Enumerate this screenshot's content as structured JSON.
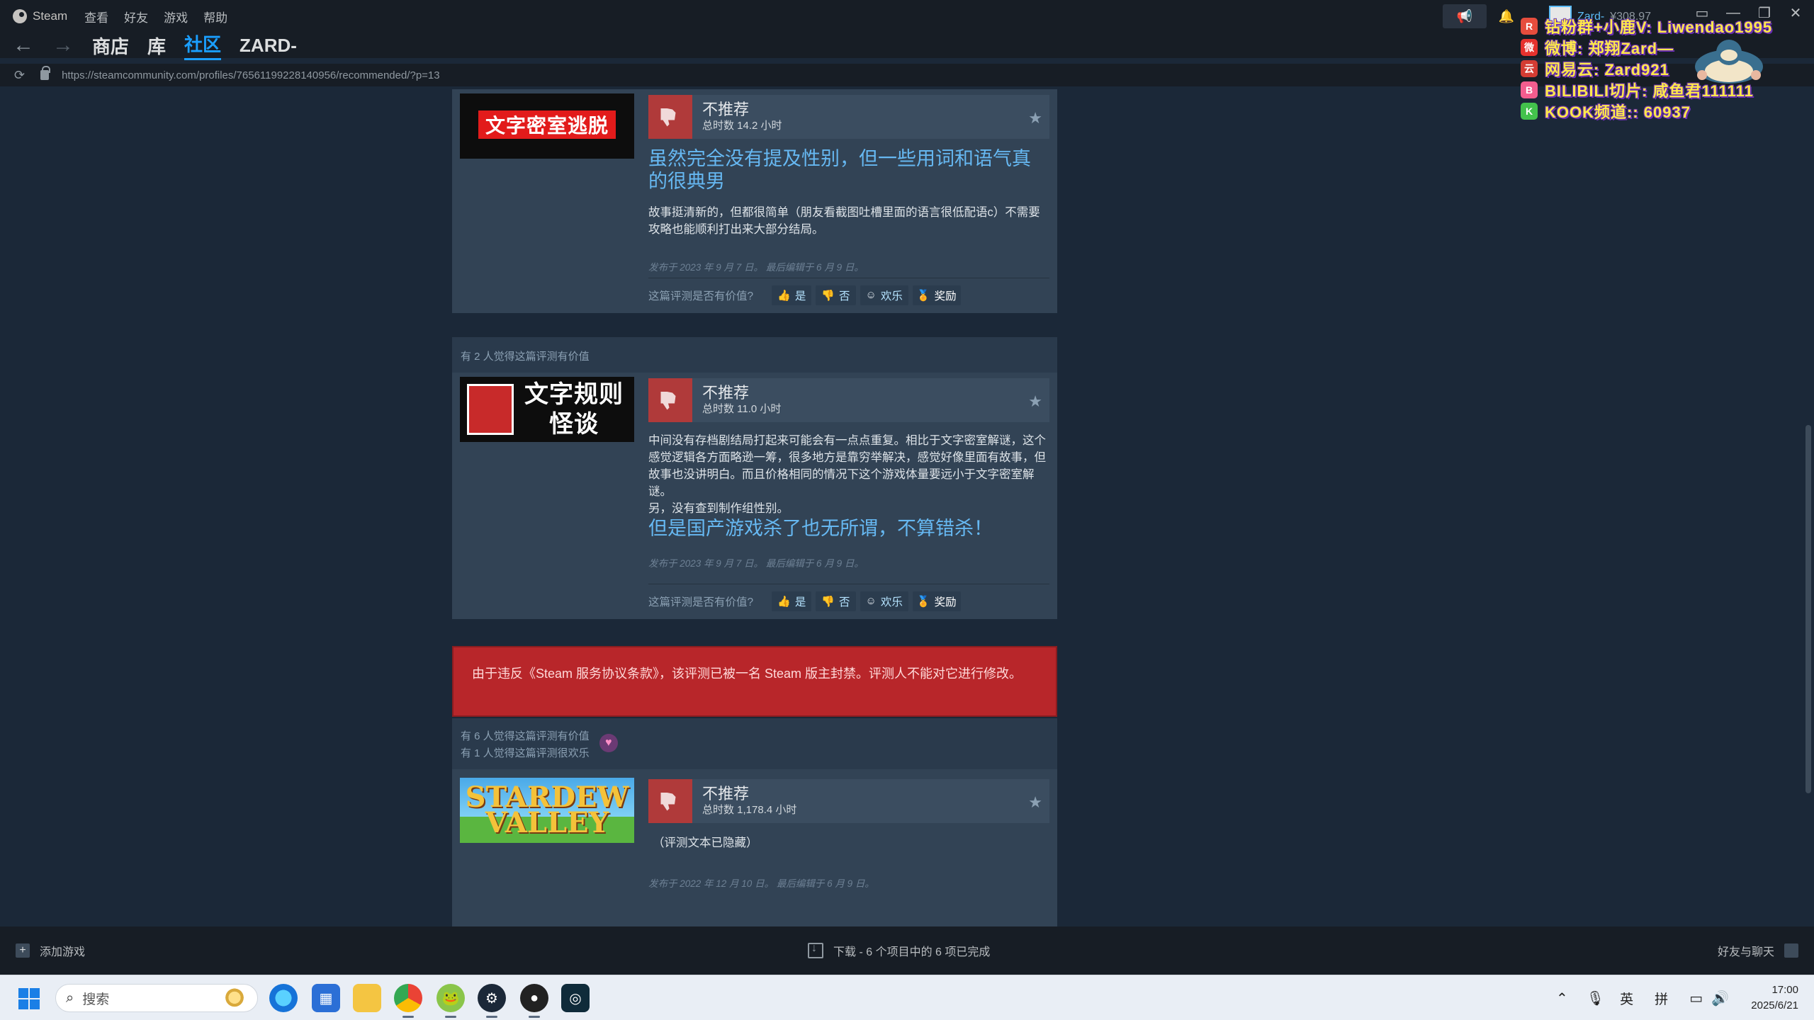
{
  "titlebar": {
    "app_name": "Steam",
    "menus": [
      "查看",
      "好友",
      "游戏",
      "帮助"
    ],
    "user": {
      "name": "Zard-",
      "wallet": "¥308.97"
    }
  },
  "nav": {
    "tabs": [
      "商店",
      "库",
      "社区",
      "ZARD-"
    ],
    "active_tab": "社区",
    "url": "https://steamcommunity.com/profiles/76561199228140956/recommended/?p=13"
  },
  "overlay": [
    {
      "icon": "R",
      "icon_color": "#e64d3d",
      "text": "钻粉群+小鹿V: Liwendao1995"
    },
    {
      "icon": "微",
      "icon_color": "#e6322e",
      "text": "微博: 郑翔Zard—"
    },
    {
      "icon": "云",
      "icon_color": "#d43c33",
      "text": "网易云: Zard921"
    },
    {
      "icon": "B",
      "icon_color": "#f25d8e",
      "text": "BILIBILI切片: 咸鱼君111111"
    },
    {
      "icon": "K",
      "icon_color": "#43c24c",
      "text": "KOOK频道:: 60937"
    }
  ],
  "reviews": [
    {
      "helpful_header": "",
      "game": "文字密室逃脱",
      "rating": "不推荐",
      "hours": "总时数 14.2 小时",
      "big_text": "虽然完全没有提及性别，但一些用词和语气真的很典男",
      "text_lines": [
        "故事挺清新的，但都很简单（朋友看截图吐槽里面的语言很低配语c）不需要攻略也能顺利打出来大部分结局。"
      ],
      "posted": "发布于 2023 年 9 月 7 日。 最后编辑于 6 月 9 日。"
    },
    {
      "helpful_header": "有 2 人觉得这篇评测有价值",
      "game": "文字规则怪谈",
      "rating": "不推荐",
      "hours": "总时数 11.0 小时",
      "text_lines": [
        "中间没有存档剧结局打起来可能会有一点点重复。相比于文字密室解谜，这个感觉逻辑各方面略逊一筹，很多地方是靠穷举解决，感觉好像里面有故事，但故事也没讲明白。而且价格相同的情况下这个游戏体量要远小于文字密室解谜。",
        "另，没有查到制作组性别。"
      ],
      "big_text": "但是国产游戏杀了也无所谓，不算错杀！",
      "posted": "发布于 2023 年 9 月 7 日。 最后编辑于 6 月 9 日。"
    },
    {
      "helpful_header": "有 6 人觉得这篇评测有价值",
      "helpful_header2": "有 1 人觉得这篇评测很欢乐",
      "game": "STARDEW VALLEY",
      "rating": "不推荐",
      "hours": "总时数 1,178.4 小时",
      "hidden_text": "（评测文本已隐藏）",
      "posted": "发布于 2022 年 12 月 10 日。 最后编辑于 6 月 9 日。"
    }
  ],
  "vote": {
    "question": "这篇评测是否有价值?",
    "yes": "是",
    "no": "否",
    "funny": "欢乐",
    "award": "奖励"
  },
  "banned_notice": "由于违反《Steam 服务协议条款》，该评测已被一名 Steam 版主封禁。评测人不能对它进行修改。",
  "bottombar": {
    "add_game": "添加游戏",
    "download": "下载 - 6 个项目中的 6 项已完成",
    "friends": "好友与聊天"
  },
  "taskbar": {
    "search_placeholder": "搜索",
    "ime1": "英",
    "ime2": "拼",
    "time": "17:00",
    "date": "2025/6/21"
  },
  "colors": {
    "accent": "#1a9fff",
    "review_bg": "#324355",
    "not_recommended": "#b03a3a",
    "banned": "#b8262a"
  }
}
